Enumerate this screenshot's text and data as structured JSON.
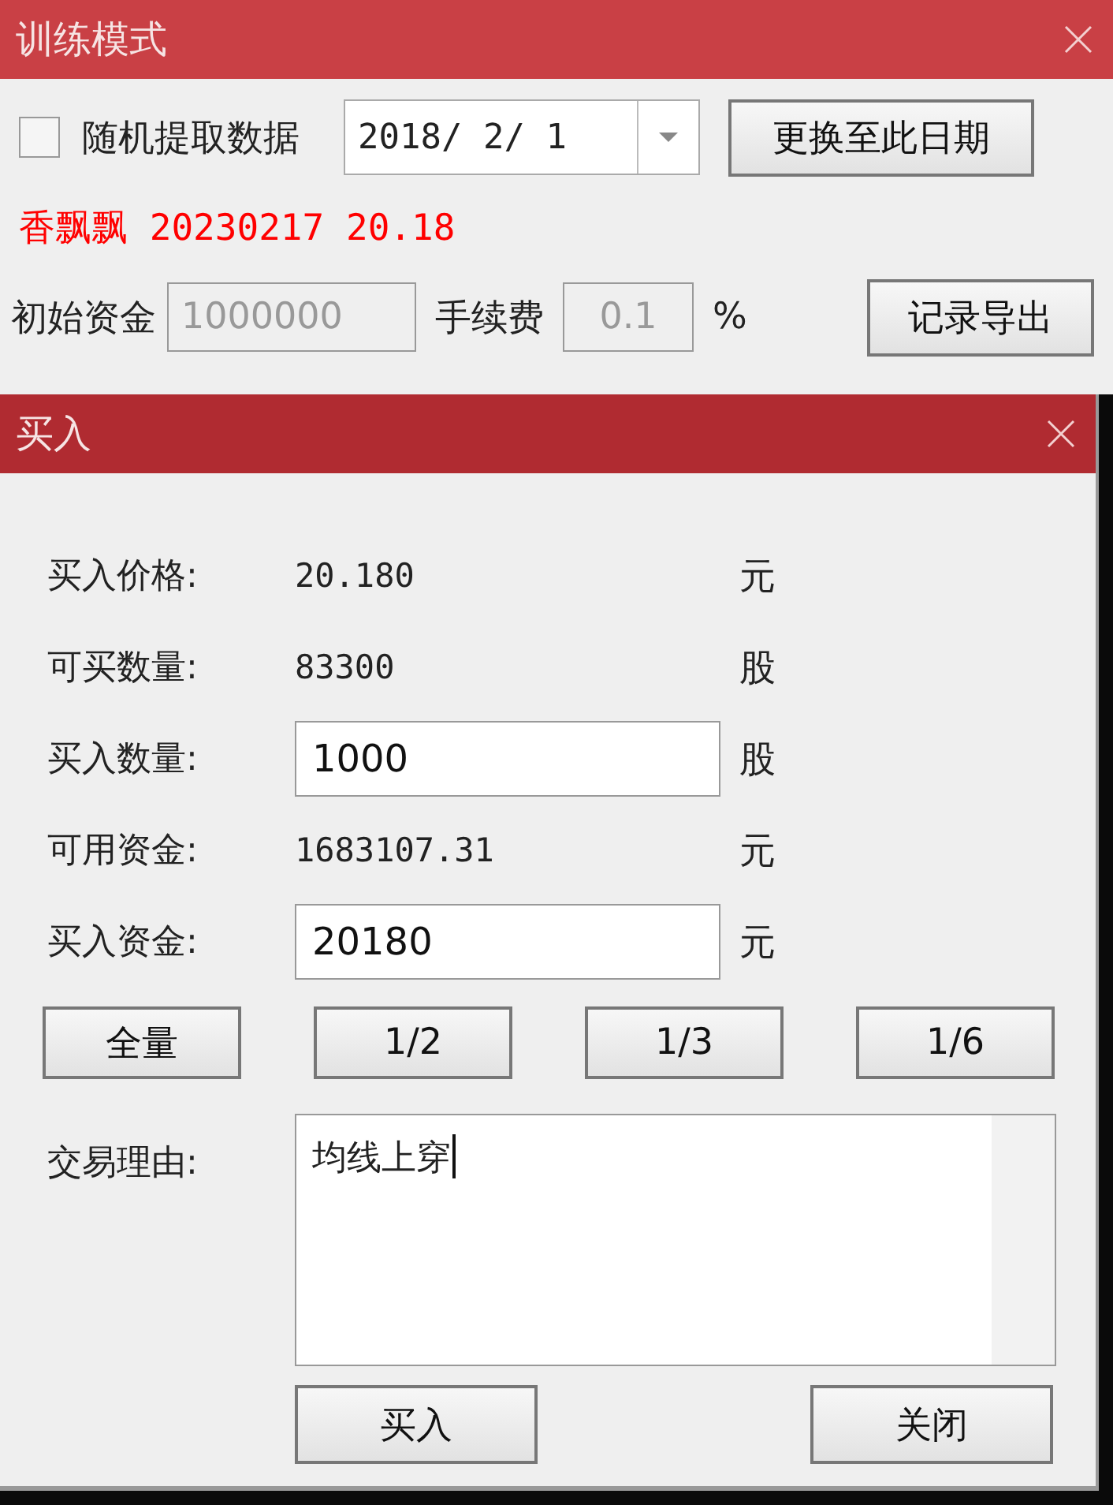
{
  "training_window": {
    "title": "训练模式",
    "random_data": {
      "label": "随机提取数据",
      "checked": false
    },
    "date": {
      "value": "2018/ 2/ 1"
    },
    "change_date_button": "更换至此日期",
    "stock_info": "香飘飘 20230217 20.18",
    "initial_capital": {
      "label": "初始资金",
      "value": "1000000"
    },
    "fee": {
      "label": "手续费",
      "value": "0.1",
      "unit": "%"
    },
    "export_button": "记录导出"
  },
  "buy_dialog": {
    "title": "买入",
    "rows": [
      {
        "kind": "text",
        "label": "买入价格:",
        "value": "20.180",
        "unit": "元"
      },
      {
        "kind": "text",
        "label": "可买数量:",
        "value": "83300",
        "unit": "股"
      },
      {
        "kind": "input",
        "label": "买入数量:",
        "value": "1000",
        "unit": "股"
      },
      {
        "kind": "text",
        "label": "可用资金:",
        "value": "1683107.31",
        "unit": "元"
      },
      {
        "kind": "input",
        "label": "买入资金:",
        "value": "20180",
        "unit": "元"
      }
    ],
    "ratio_buttons": [
      "全量",
      "1/2",
      "1/3",
      "1/6"
    ],
    "reason": {
      "label": "交易理由:",
      "value": "均线上穿"
    },
    "buttons": [
      "买入",
      "关闭"
    ]
  }
}
